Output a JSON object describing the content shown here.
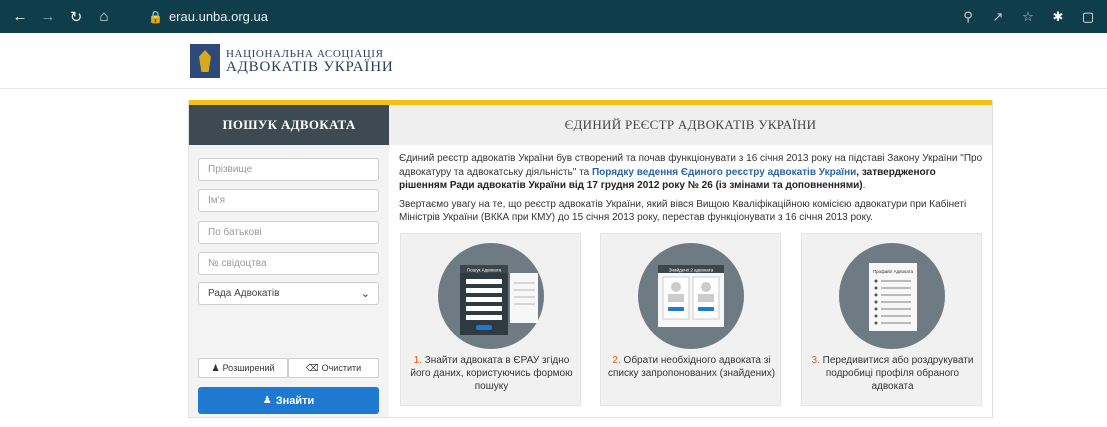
{
  "browser": {
    "url": "erau.unba.org.ua",
    "back_icon": "arrow-left",
    "forward_icon": "arrow-right",
    "reload_icon": "reload",
    "home_icon": "home",
    "lock_icon": "lock"
  },
  "site": {
    "logo_line1": "НАЦІОНАЛЬНА АСОЦІАЦІЯ",
    "logo_line2": "АДВОКАТІВ УКРАЇНИ"
  },
  "tabs": {
    "search": "ПОШУК АДВОКАТА",
    "registry": "ЄДИНИЙ РЕЄСТР АДВОКАТІВ УКРАЇНИ"
  },
  "form": {
    "surname_placeholder": "Прізвище",
    "name_placeholder": "Ім'я",
    "patronymic_placeholder": "По батькові",
    "certificate_placeholder": "№ свідоцтва",
    "council_select": "Рада Адвокатів",
    "advanced_label": "Розширений",
    "clear_label": "Очистити",
    "search_label": "Знайти"
  },
  "intro": {
    "p1_part1": "Єдиний реєстр адвокатів України був створений та почав функціонувати з 16 січня 2013 року на підставі Закону України \"Про адвокатуру та адвокатську діяльність\" та ",
    "p1_link": "Порядку ведення Єдиного реєстру адвокатів України",
    "p1_bold": ", затвердженого рішенням Ради адвокатів України від 17 грудня 2012 року № 26 (із змінами та доповненнями)",
    "p1_end": ".",
    "p2": "Звертаємо увагу на те, що реєстр адвокатів України, який вівся Вищою Кваліфікаційною комісією адвокатури при Кабінеті Міністрів України (ВККА при КМУ) до 15 січня 2013 року, перестав функціонувати з 16 січня 2013 року."
  },
  "cards": [
    {
      "num": "1.",
      "text_a": "Знайти адвоката в ЄРАУ згідно його даних, користуючись формою пошуку",
      "screen_title": "Пошук Адвоката"
    },
    {
      "num": "2.",
      "text_a": "Обрати необхідного адвоката зі списку запропонованих (знайдених)",
      "screen_title": "Знайдено 2 адвоката"
    },
    {
      "num": "3.",
      "text_a": "Передивитися або роздрукувати подробиці профіля обраного адвоката",
      "screen_title": "Профайл Адвоката"
    }
  ],
  "colors": {
    "accent_yellow": "#f3c016",
    "button_blue": "#1e7ad1",
    "tab_dark": "#3d4a52",
    "step_orange": "#e05a17"
  }
}
